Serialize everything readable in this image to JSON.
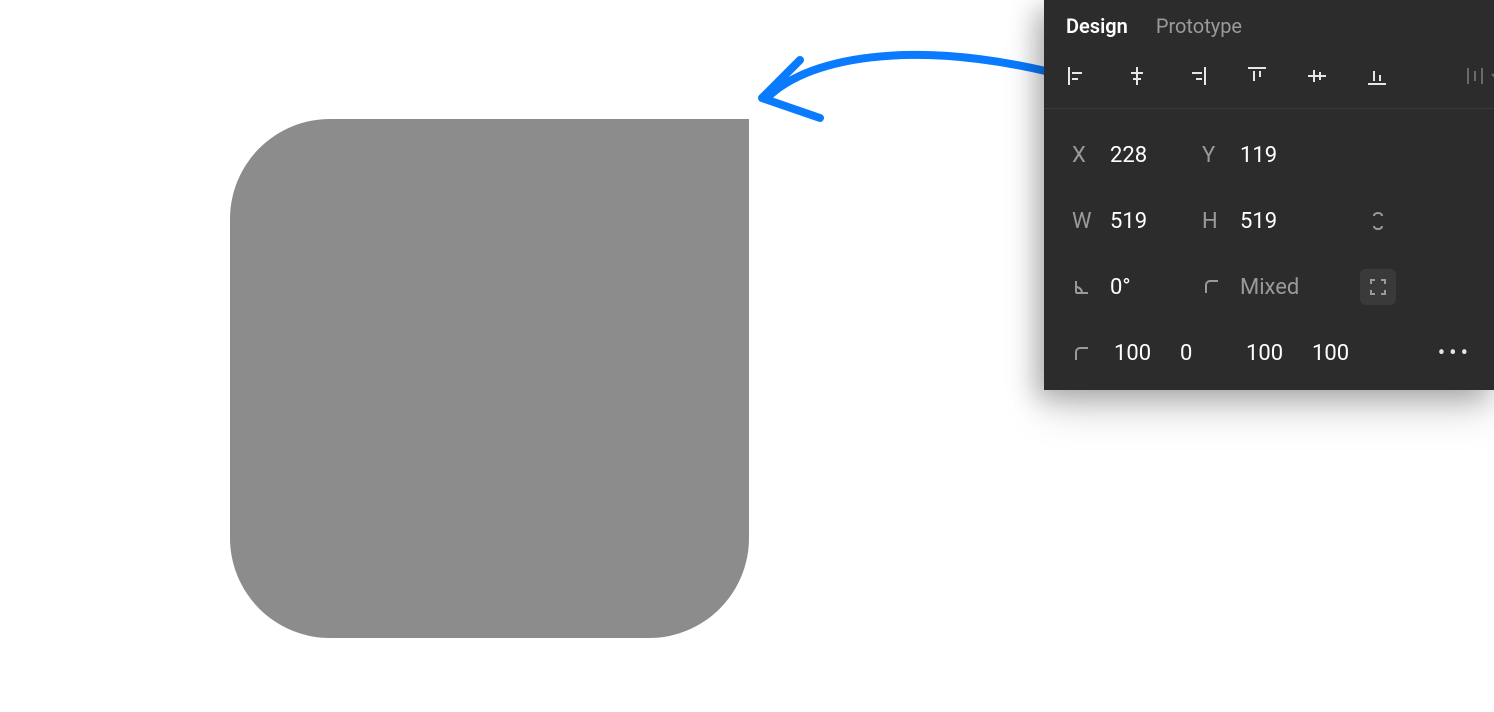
{
  "tabs": {
    "design": "Design",
    "prototype": "Prototype"
  },
  "position": {
    "x_label": "X",
    "x_value": "228",
    "y_label": "Y",
    "y_value": "119"
  },
  "size": {
    "w_label": "W",
    "w_value": "519",
    "h_label": "H",
    "h_value": "519"
  },
  "transform": {
    "rotation_value": "0°",
    "radius_value": "Mixed"
  },
  "corners": {
    "tl": "100",
    "tr": "0",
    "br": "100",
    "bl": "100"
  },
  "shape": {
    "fill": "#8c8c8c",
    "corner_tl": 100,
    "corner_tr": 0,
    "corner_br": 100,
    "corner_bl": 100
  }
}
